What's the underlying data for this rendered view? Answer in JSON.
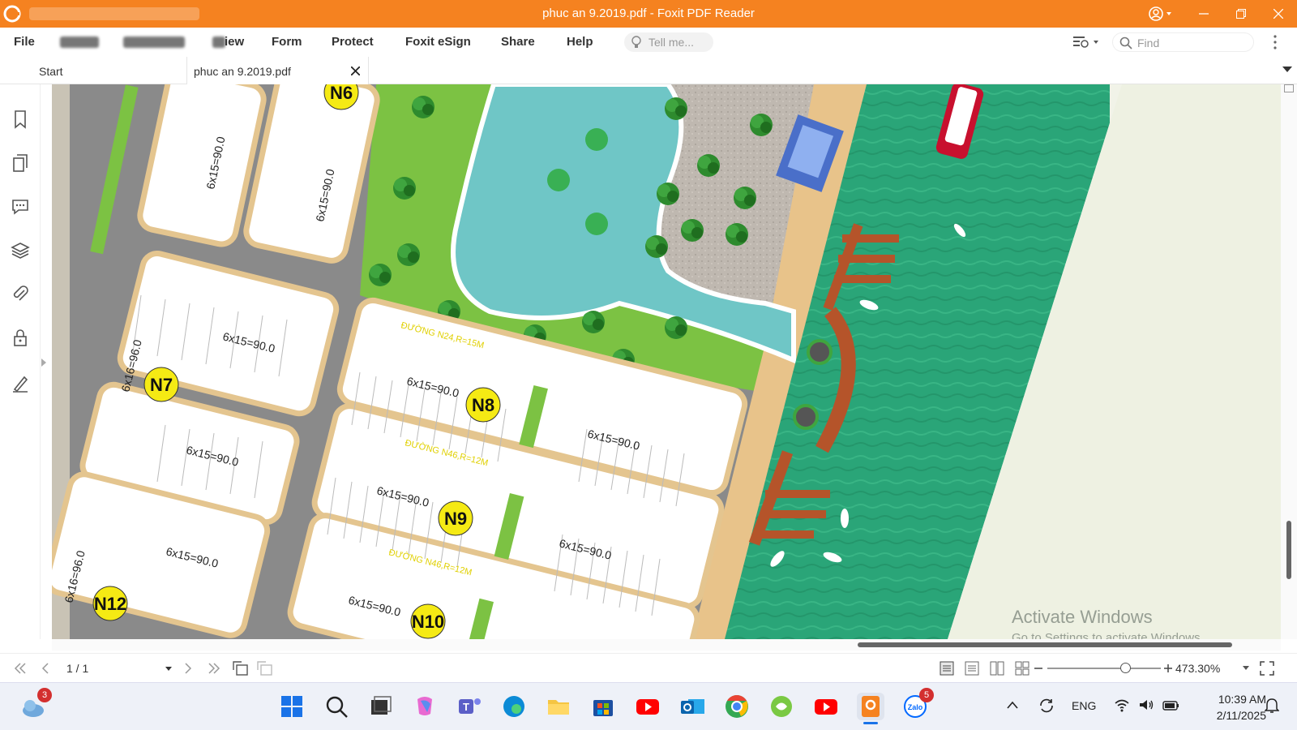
{
  "window": {
    "title": "phuc an 9.2019.pdf - Foxit PDF Reader",
    "accent_color": "#f58220"
  },
  "menu": {
    "items": [
      "File",
      "Form",
      "Protect",
      "Foxit eSign",
      "Share",
      "Help"
    ],
    "view_partial": "iew",
    "tell_me_placeholder": "Tell me...",
    "find_placeholder": "Find"
  },
  "tabs": {
    "start": "Start",
    "document": "phuc an 9.2019.pdf"
  },
  "map": {
    "blocks": [
      "N6",
      "N7",
      "N8",
      "N9",
      "N10",
      "N12"
    ],
    "streets": [
      "ĐƯỜNG N24,R=15M",
      "ĐƯỜNG N46,R=12M",
      "ĐƯỜNG N46,R=12M"
    ],
    "lot_label": "6x15=90.0",
    "lot_label_vertical": "6x15=90.0",
    "lot_label_n7": "6x16=96.0"
  },
  "watermark": {
    "line1": "Activate Windows",
    "line2": "Go to Settings to activate Windows."
  },
  "status": {
    "page": "1 / 1",
    "zoom": "473.30%"
  },
  "taskbar": {
    "weather_badge": "3",
    "zalo_badge": "5",
    "language": "ENG",
    "time": "10:39 AM",
    "date": "2/11/2025"
  }
}
